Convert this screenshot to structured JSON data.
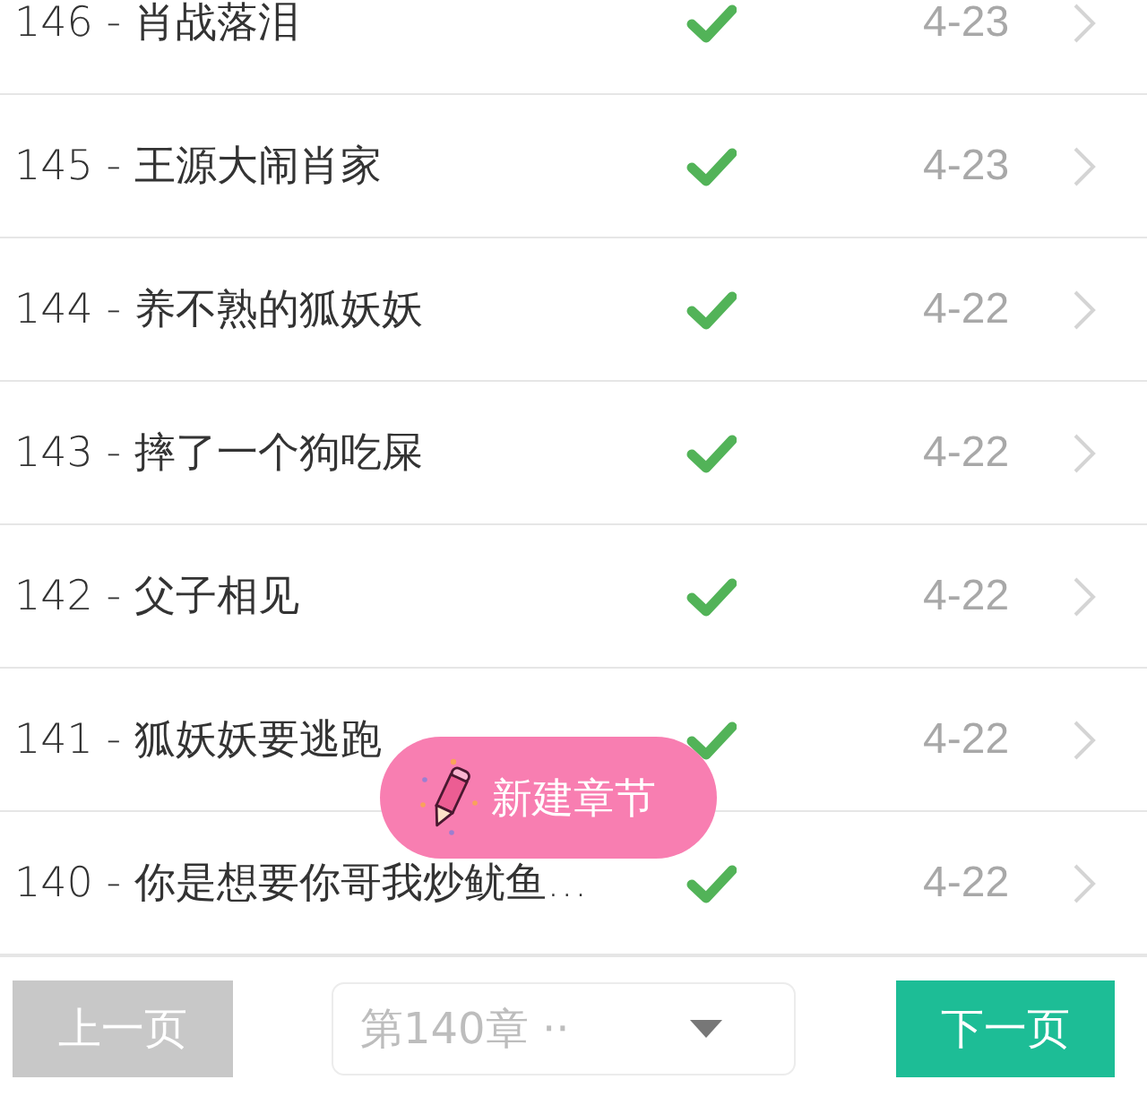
{
  "chapters": [
    {
      "title": "146 - 肖战落泪",
      "checked": true,
      "date": "4-23"
    },
    {
      "title": "145 - 王源大闹肖家",
      "checked": true,
      "date": "4-23"
    },
    {
      "title": "144 - 养不熟的狐妖妖",
      "checked": true,
      "date": "4-22"
    },
    {
      "title": "143 - 摔了一个狗吃屎",
      "checked": true,
      "date": "4-22"
    },
    {
      "title": "142 - 父子相见",
      "checked": true,
      "date": "4-22"
    },
    {
      "title": "141 - 狐妖妖要逃跑",
      "checked": true,
      "date": "4-22"
    },
    {
      "title": "140 - 你是想要你哥我炒鱿鱼…",
      "checked": true,
      "date": "4-22"
    }
  ],
  "new_chapter_button": {
    "label": "新建章节"
  },
  "pagination": {
    "prev": {
      "label": "上一页",
      "disabled": true
    },
    "chapter_select": {
      "value": "第140章 ··"
    },
    "next": {
      "label": "下一页",
      "disabled": false
    }
  }
}
